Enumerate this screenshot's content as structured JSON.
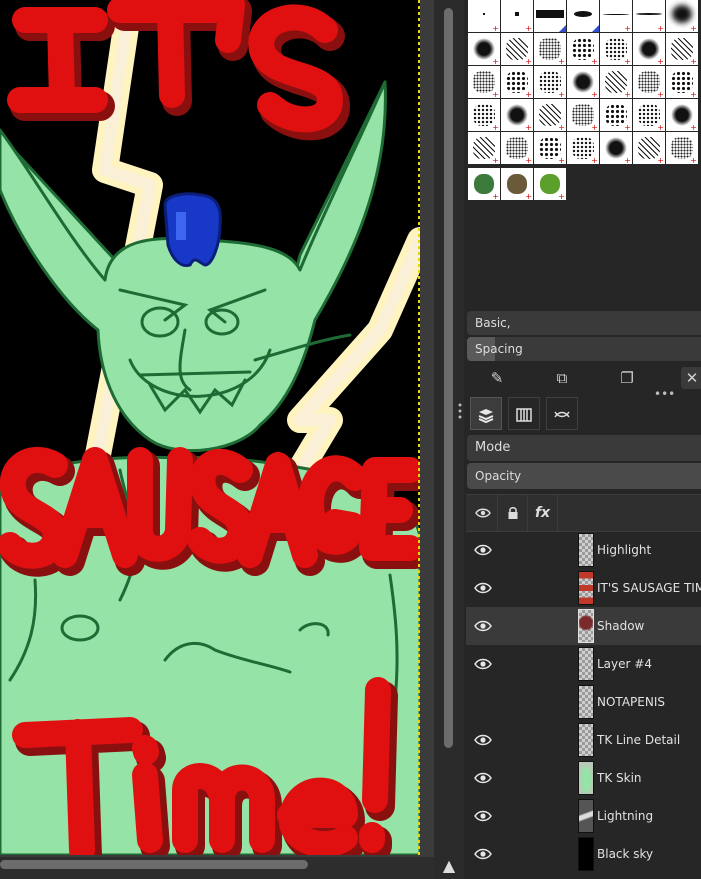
{
  "canvas": {
    "title_top": "IT'S",
    "title_middle": "SAUSAGE",
    "title_bottom": "Time!"
  },
  "brush_panel": {
    "preset_label": "Basic,",
    "spacing_label": "Spacing"
  },
  "layers_panel": {
    "mode_label": "Mode",
    "opacity_label": "Opacity",
    "fx_label": "fx",
    "layers": [
      {
        "name": "Highlight",
        "visible": true
      },
      {
        "name": "IT'S SAUSAGE TIME",
        "visible": true
      },
      {
        "name": "Shadow",
        "visible": true,
        "selected": true
      },
      {
        "name": "Layer #4",
        "visible": true
      },
      {
        "name": "NOTAPENIS",
        "visible": false
      },
      {
        "name": "TK Line Detail",
        "visible": true
      },
      {
        "name": "TK Skin",
        "visible": true
      },
      {
        "name": "Lightning",
        "visible": true
      },
      {
        "name": "Black sky",
        "visible": true
      }
    ]
  },
  "colors": {
    "canvas_bg": "#000000",
    "skin": "#95e3a6",
    "text_red": "#e01010",
    "text_shadow": "#8a1010",
    "lightning": "#fff4c0",
    "hat_blue": "#1838c8",
    "panel_bg": "#262626",
    "selection_border": "#e8d800"
  }
}
